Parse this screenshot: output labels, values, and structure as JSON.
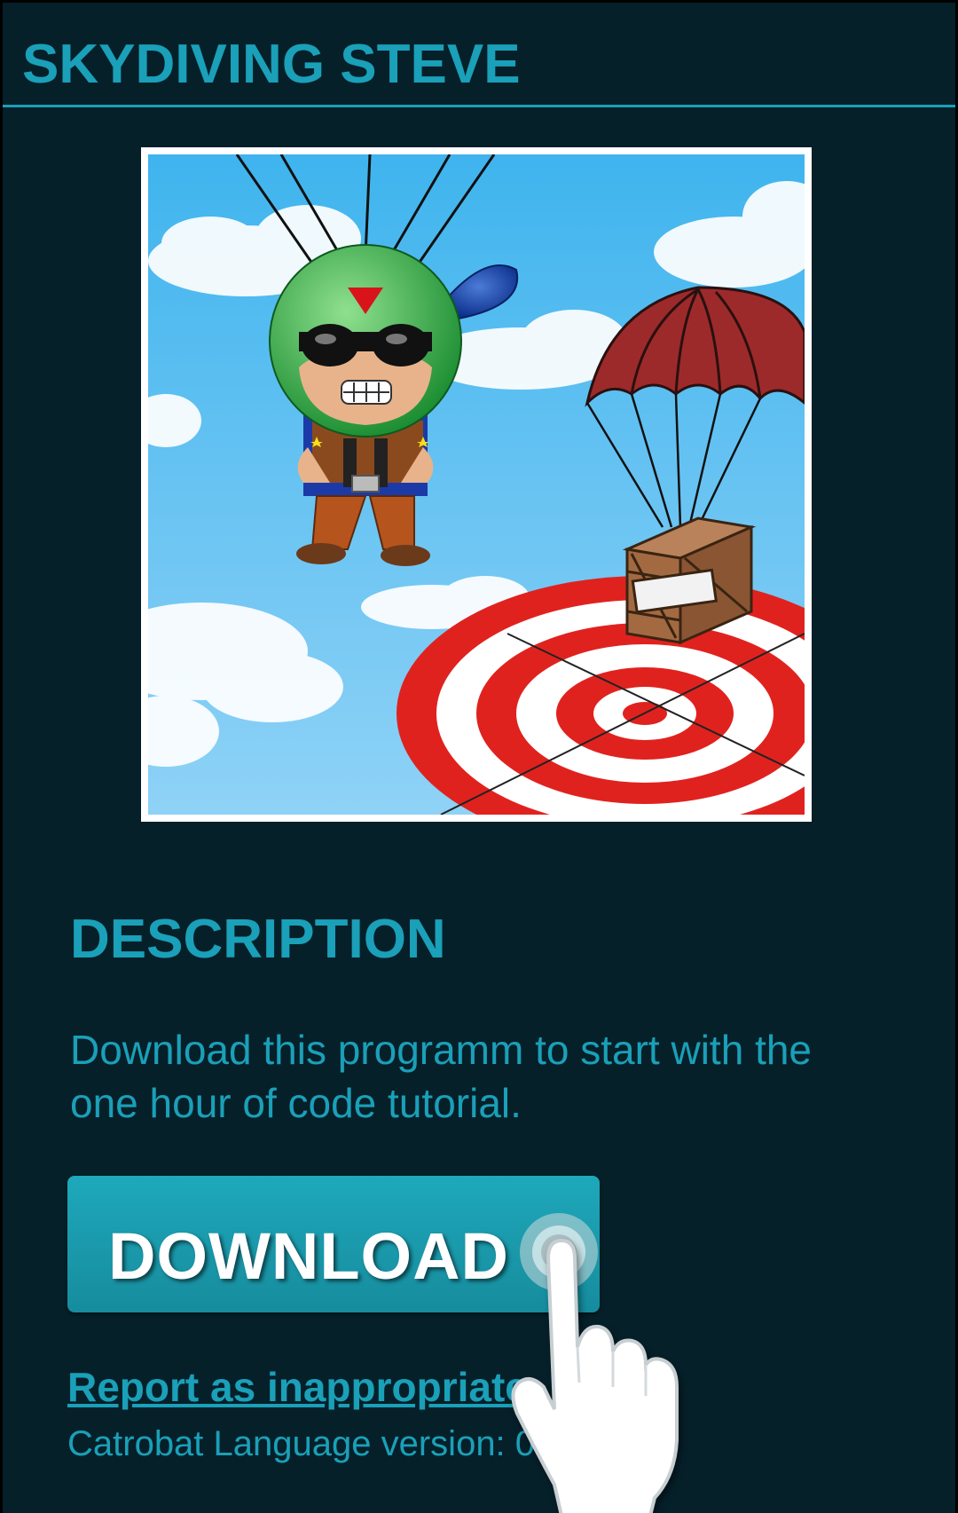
{
  "app": {
    "title": "SKYDIVING STEVE"
  },
  "thumbnail": {
    "alt": "Skydiving Steve program thumbnail"
  },
  "description": {
    "heading": "DESCRIPTION",
    "text": "Download this programm to start with the one hour of code tutorial."
  },
  "actions": {
    "download_label": "DOWNLOAD",
    "report_label": "Report as inappropriate",
    "language_version": "Catrobat Language version: 0"
  },
  "colors": {
    "background": "#06202a",
    "accent": "#1aa0b8",
    "button": "#1ea8bb"
  }
}
